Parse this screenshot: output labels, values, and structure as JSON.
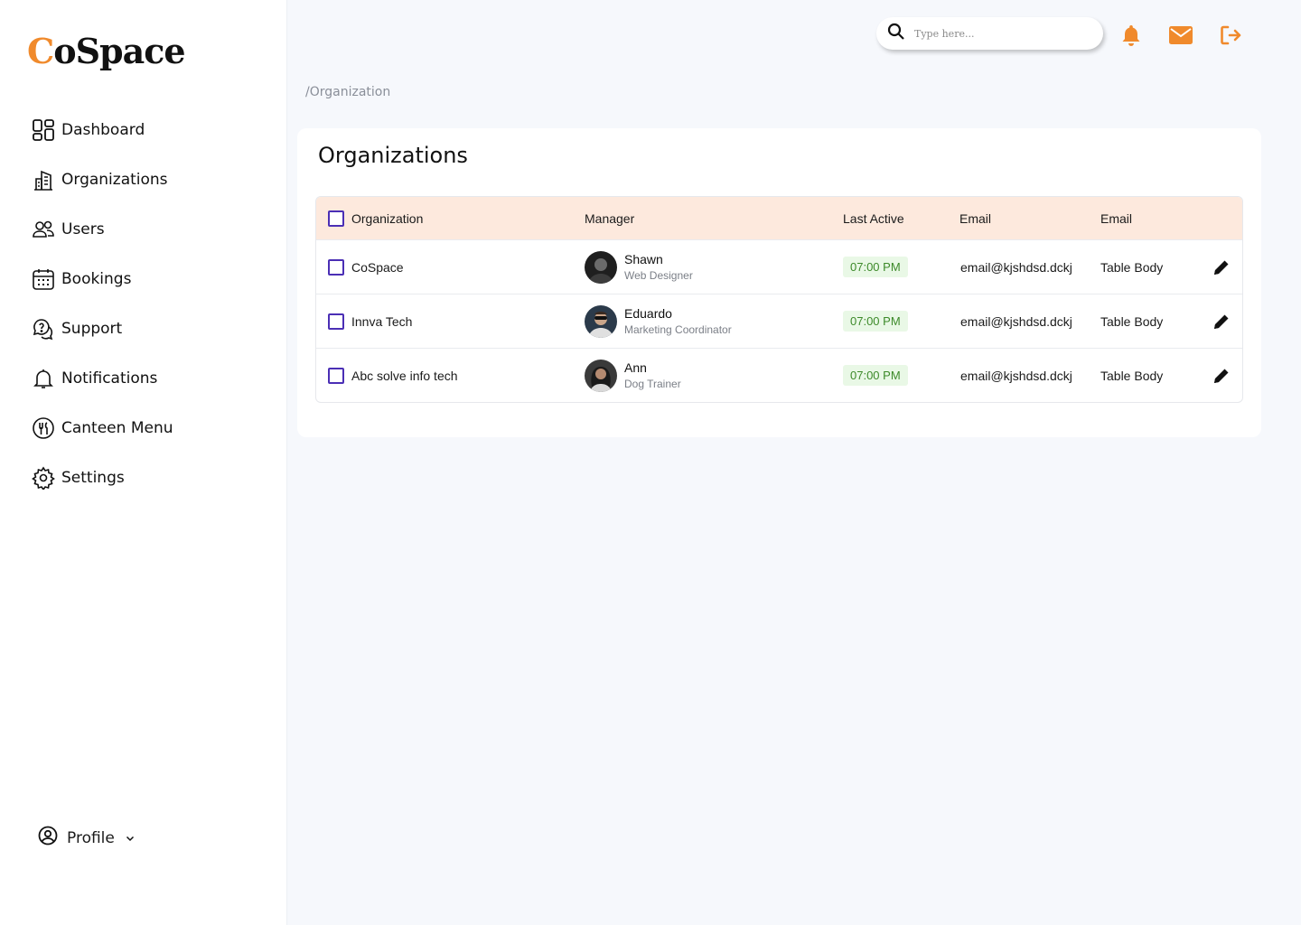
{
  "app": {
    "logo_first": "C",
    "logo_rest": "oSpace",
    "accent_color": "#f08a2c",
    "checkbox_color": "#4b2fb5"
  },
  "sidebar": {
    "items": [
      {
        "label": "Dashboard",
        "icon": "dashboard-icon"
      },
      {
        "label": "Organizations",
        "icon": "building-icon"
      },
      {
        "label": "Users",
        "icon": "users-icon"
      },
      {
        "label": "Bookings",
        "icon": "calendar-icon"
      },
      {
        "label": "Support",
        "icon": "support-icon"
      },
      {
        "label": "Notifications",
        "icon": "bell-icon"
      },
      {
        "label": "Canteen Menu",
        "icon": "canteen-icon"
      },
      {
        "label": "Settings",
        "icon": "gear-icon"
      }
    ],
    "profile_label": "Profile"
  },
  "header": {
    "search_placeholder": "Type here...",
    "icons": [
      "bell-icon",
      "mail-icon",
      "logout-icon"
    ]
  },
  "breadcrumb": "/Organization",
  "page_title": "Organizations",
  "table": {
    "columns": [
      "Organization",
      "Manager",
      "Last Active",
      "Email",
      "Email"
    ],
    "rows": [
      {
        "organization": "CoSpace",
        "manager_name": "Shawn",
        "manager_role": "Web Designer",
        "last_active": "07:00 PM",
        "email": "email@kjshdsd.dckj",
        "email2": "Table Body"
      },
      {
        "organization": "Innva Tech",
        "manager_name": "Eduardo",
        "manager_role": "Marketing Coordinator",
        "last_active": "07:00 PM",
        "email": "email@kjshdsd.dckj",
        "email2": "Table Body"
      },
      {
        "organization": "Abc solve info tech",
        "manager_name": "Ann",
        "manager_role": "Dog Trainer",
        "last_active": "07:00 PM",
        "email": "email@kjshdsd.dckj",
        "email2": "Table Body"
      }
    ]
  }
}
